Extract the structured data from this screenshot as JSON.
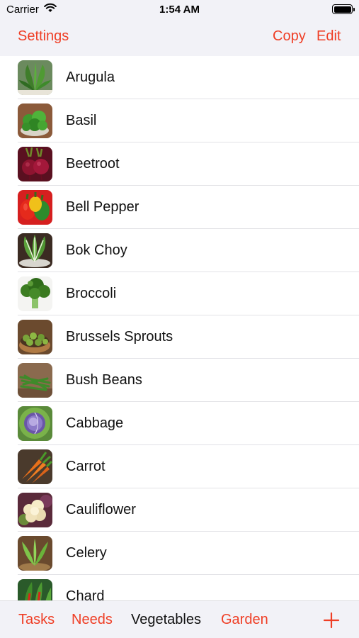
{
  "status_bar": {
    "carrier": "Carrier",
    "time": "1:54 AM"
  },
  "nav": {
    "settings_label": "Settings",
    "copy_label": "Copy",
    "edit_label": "Edit"
  },
  "vegetables": [
    {
      "label": "Arugula",
      "icon": "arugula-icon"
    },
    {
      "label": "Basil",
      "icon": "basil-icon"
    },
    {
      "label": "Beetroot",
      "icon": "beetroot-icon"
    },
    {
      "label": "Bell Pepper",
      "icon": "bell-pepper-icon"
    },
    {
      "label": "Bok Choy",
      "icon": "bok-choy-icon"
    },
    {
      "label": "Broccoli",
      "icon": "broccoli-icon"
    },
    {
      "label": "Brussels Sprouts",
      "icon": "brussels-sprouts-icon"
    },
    {
      "label": "Bush Beans",
      "icon": "bush-beans-icon"
    },
    {
      "label": "Cabbage",
      "icon": "cabbage-icon"
    },
    {
      "label": "Carrot",
      "icon": "carrot-icon"
    },
    {
      "label": "Cauliflower",
      "icon": "cauliflower-icon"
    },
    {
      "label": "Celery",
      "icon": "celery-icon"
    },
    {
      "label": "Chard",
      "icon": "chard-icon"
    }
  ],
  "tab_bar": {
    "tasks_label": "Tasks",
    "needs_label": "Needs",
    "vegetables_label": "Vegetables",
    "garden_label": "Garden",
    "active_tab": "Vegetables"
  },
  "colors": {
    "accent": "#ef3e25",
    "bar_background": "#f2f2f7",
    "separator": "#e2e2e6"
  }
}
